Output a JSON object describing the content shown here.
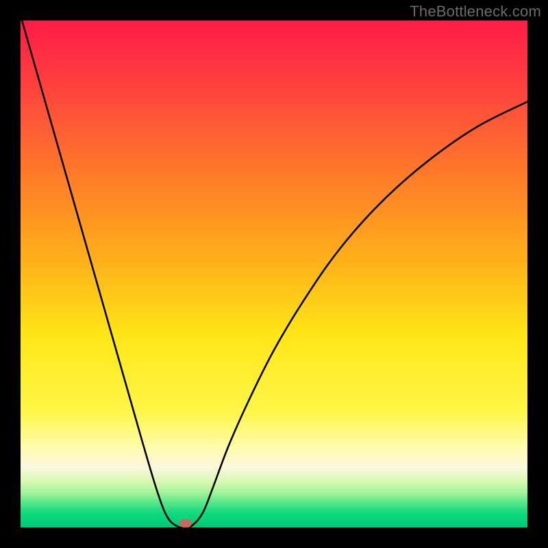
{
  "watermark": "TheBottleneck.com",
  "chart_data": {
    "type": "line",
    "title": "",
    "xlabel": "",
    "ylabel": "",
    "xlim": [
      0,
      100
    ],
    "ylim": [
      0,
      100
    ],
    "grid": false,
    "legend": false,
    "background_gradient": {
      "stops": [
        {
          "pct": 0,
          "color": "#ff1c47"
        },
        {
          "pct": 12,
          "color": "#ff3f3f"
        },
        {
          "pct": 30,
          "color": "#ff7a2a"
        },
        {
          "pct": 48,
          "color": "#ffb31a"
        },
        {
          "pct": 62,
          "color": "#ffe617"
        },
        {
          "pct": 77,
          "color": "#fff648"
        },
        {
          "pct": 84,
          "color": "#fffca8"
        },
        {
          "pct": 88,
          "color": "#fef7de"
        },
        {
          "pct": 91,
          "color": "#d9f8b4"
        },
        {
          "pct": 93,
          "color": "#a6f59a"
        },
        {
          "pct": 95,
          "color": "#5de88b"
        },
        {
          "pct": 97,
          "color": "#14da7e"
        },
        {
          "pct": 100,
          "color": "#00c877"
        }
      ]
    },
    "series": [
      {
        "name": "bottleneck-curve",
        "x": [
          0,
          4,
          8,
          12,
          16,
          20,
          24,
          27,
          29,
          31,
          32.5,
          34,
          36,
          38,
          41,
          45,
          50,
          56,
          63,
          71,
          80,
          90,
          100
        ],
        "y": [
          101,
          87,
          73,
          59,
          45,
          31,
          17,
          7,
          2,
          0.2,
          0,
          0.5,
          3,
          8,
          16,
          25,
          35,
          45,
          55,
          64,
          72,
          79,
          84
        ]
      }
    ],
    "min_marker": {
      "x": 32.5,
      "y": 0.8,
      "color": "#c76a5e"
    }
  }
}
